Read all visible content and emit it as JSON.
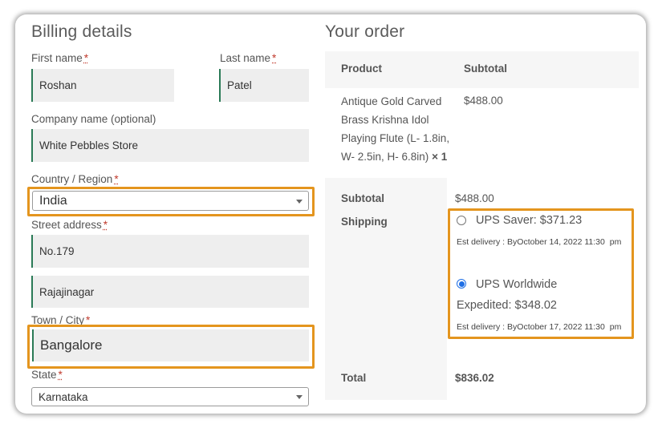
{
  "billing": {
    "title": "Billing details",
    "first_name": {
      "label": "First name",
      "required": "*",
      "value": "Roshan"
    },
    "last_name": {
      "label": "Last name",
      "required": "*",
      "value": "Patel"
    },
    "company": {
      "label": "Company name (optional)",
      "value": "White Pebbles Store"
    },
    "country": {
      "label": "Country / Region",
      "required": "*",
      "value": "India"
    },
    "street": {
      "label": "Street address",
      "required": "*",
      "line1": "No.179",
      "line2": "Rajajinagar"
    },
    "town": {
      "label": "Town / City",
      "required": "*",
      "value": "Bangalore"
    },
    "state": {
      "label": "State",
      "required": "*",
      "value": "Karnataka"
    }
  },
  "order": {
    "title": "Your order",
    "col_product": "Product",
    "col_subtotal": "Subtotal",
    "item": {
      "name_lines": [
        "Antique Gold Carved",
        "Brass Krishna Idol",
        "Playing Flute (L- 1.8in,",
        "W- 2.5in, H- 6.8in)"
      ],
      "qty": "× 1",
      "price": "$488.00"
    },
    "subtotal_label": "Subtotal",
    "subtotal_value": "$488.00",
    "shipping_label": "Shipping",
    "shipping_options": [
      {
        "label": "UPS Saver: $371.23",
        "delivery": "Est delivery : ByOctober 14, 2022 11:30",
        "delivery_suffix": "pm",
        "selected": false
      },
      {
        "label_line1": "UPS Worldwide",
        "label_line2": "Expedited: $348.02",
        "delivery": "Est delivery : ByOctober 17, 2022 11:30",
        "delivery_suffix": "pm",
        "selected": true
      }
    ],
    "total_label": "Total",
    "total_value": "$836.02"
  },
  "colors": {
    "highlight": "#e4951e",
    "field_accent": "#2a7a56",
    "radio_selected": "#1f6fe5"
  }
}
